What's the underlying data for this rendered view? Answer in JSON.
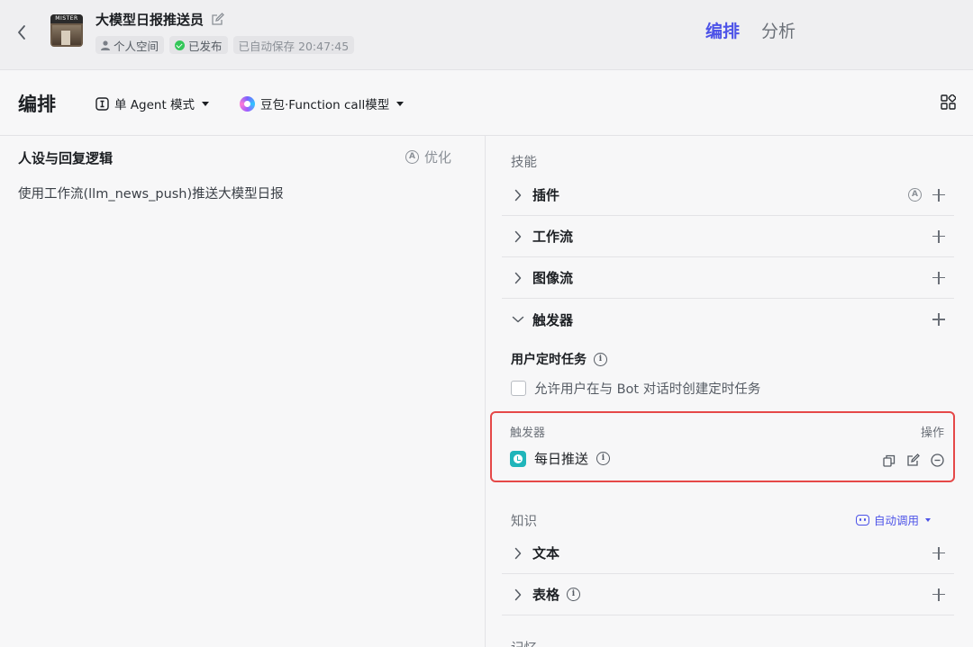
{
  "header": {
    "bot_name": "大模型日报推送员",
    "avatar_sign": "MISTER",
    "space_tag": "个人空间",
    "publish_status": "已发布",
    "autosave": "已自动保存 20:47:45",
    "tabs": [
      {
        "label": "编排",
        "active": true
      },
      {
        "label": "分析",
        "active": false
      }
    ]
  },
  "toolbar": {
    "title": "编排",
    "mode_label": "单 Agent 模式",
    "model_label": "豆包·Function call模型"
  },
  "prompt_panel": {
    "title": "人设与回复逻辑",
    "optimize_label": "优化",
    "content": "使用工作流(llm_news_push)推送大模型日报"
  },
  "skills": {
    "section_title": "技能",
    "items": [
      {
        "label": "插件",
        "expanded": false
      },
      {
        "label": "工作流",
        "expanded": false
      },
      {
        "label": "图像流",
        "expanded": false
      },
      {
        "label": "触发器",
        "expanded": true
      }
    ],
    "user_schedule_title": "用户定时任务",
    "allow_schedule_label": "允许用户在与 Bot 对话时创建定时任务",
    "allow_schedule_checked": false,
    "trigger_table": {
      "col_trigger": "触发器",
      "col_ops": "操作",
      "trigger_name": "每日推送"
    }
  },
  "knowledge": {
    "section_title": "知识",
    "auto_call_label": "自动调用",
    "items": [
      {
        "label": "文本"
      },
      {
        "label": "表格"
      }
    ],
    "next_section_partial": "记忆"
  },
  "colors": {
    "accent": "#4d53e8",
    "highlight_border": "#e54848",
    "published_green": "#34c759",
    "trigger_icon": "#1fb5ba"
  }
}
